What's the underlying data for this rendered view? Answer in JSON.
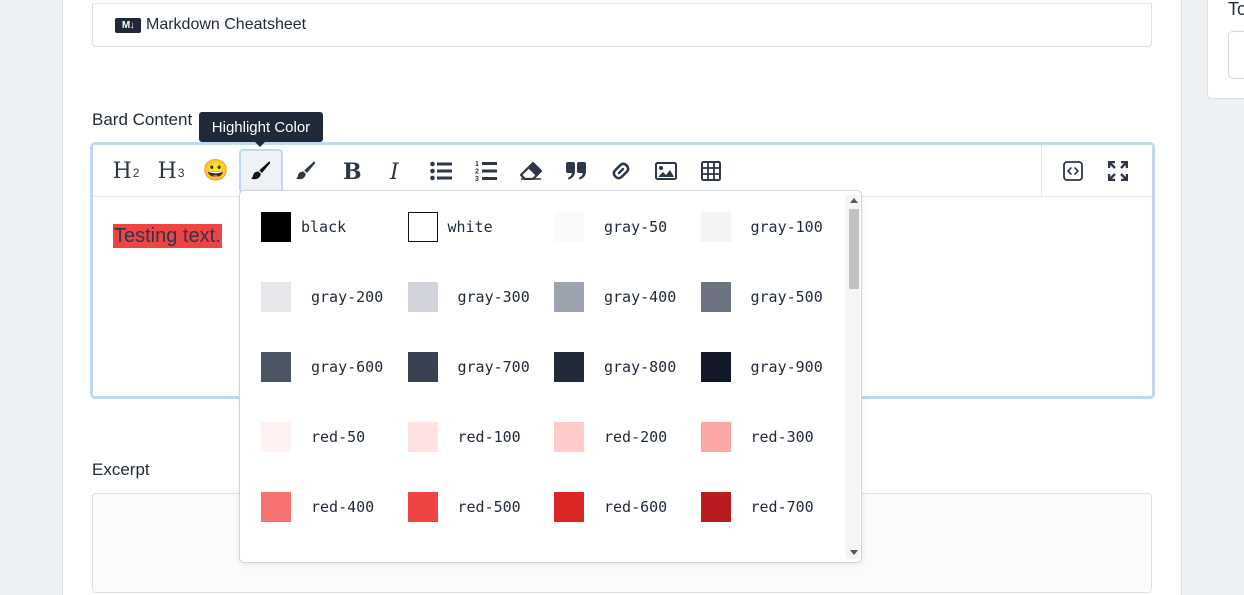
{
  "markdown_bar": {
    "icon_text": "M↓",
    "label": "Markdown Cheatsheet"
  },
  "sidebar": {
    "label": "To"
  },
  "bard": {
    "label": "Bard Content",
    "content_text": "Testing text.",
    "highlight_color": "#ef4444"
  },
  "toolbar": {
    "h2": "H",
    "h2_sub": "2",
    "h3": "H",
    "h3_sub": "3",
    "emoji": "😀",
    "tooltip": "Highlight Color",
    "buttons": [
      "heading-2",
      "heading-3",
      "emoji",
      "highlight-color",
      "text-color",
      "bold",
      "italic",
      "bullet-list",
      "ordered-list",
      "clear-format",
      "blockquote",
      "link",
      "image",
      "table",
      "source-code",
      "fullscreen"
    ]
  },
  "excerpt": {
    "label": "Excerpt"
  },
  "palette": [
    {
      "name": "black",
      "color": "#000000"
    },
    {
      "name": "white",
      "color": "#ffffff"
    },
    {
      "name": "gray-50",
      "color": "#f9fafb"
    },
    {
      "name": "gray-100",
      "color": "#f3f4f6"
    },
    {
      "name": "gray-200",
      "color": "#e5e7eb"
    },
    {
      "name": "gray-300",
      "color": "#d1d5db"
    },
    {
      "name": "gray-400",
      "color": "#9ca3af"
    },
    {
      "name": "gray-500",
      "color": "#6b7280"
    },
    {
      "name": "gray-600",
      "color": "#4b5563"
    },
    {
      "name": "gray-700",
      "color": "#374151"
    },
    {
      "name": "gray-800",
      "color": "#1f2937"
    },
    {
      "name": "gray-900",
      "color": "#111827"
    },
    {
      "name": "red-50",
      "color": "#fef2f2"
    },
    {
      "name": "red-100",
      "color": "#fee2e2"
    },
    {
      "name": "red-200",
      "color": "#fecaca"
    },
    {
      "name": "red-300",
      "color": "#fca5a5"
    },
    {
      "name": "red-400",
      "color": "#f87171"
    },
    {
      "name": "red-500",
      "color": "#ef4444"
    },
    {
      "name": "red-600",
      "color": "#dc2626"
    },
    {
      "name": "red-700",
      "color": "#b91c1c"
    }
  ]
}
